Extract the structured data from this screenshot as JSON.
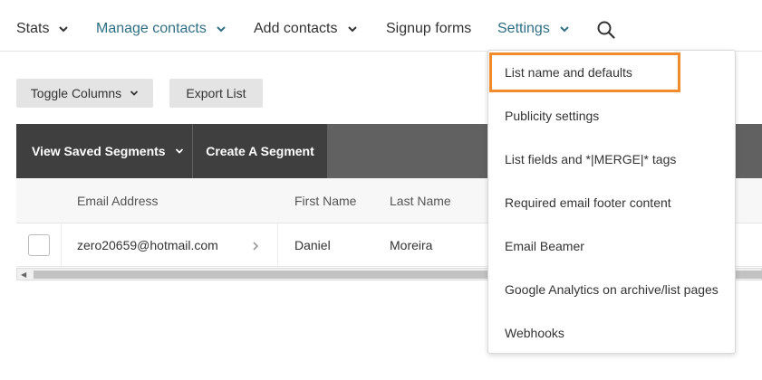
{
  "nav": {
    "stats": "Stats",
    "manage_contacts": "Manage contacts",
    "add_contacts": "Add contacts",
    "signup_forms": "Signup forms",
    "settings": "Settings",
    "search_icon": "search-icon"
  },
  "toolbar": {
    "toggle_columns": "Toggle Columns",
    "export_list": "Export List"
  },
  "segments": {
    "view_saved": "View Saved Segments",
    "create": "Create A Segment"
  },
  "table": {
    "headers": [
      "Email Address",
      "First Name",
      "Last Name"
    ],
    "rows": [
      {
        "email": "zero20659@hotmail.com",
        "first_name": "Daniel",
        "last_name": "Moreira"
      }
    ]
  },
  "settings_menu": {
    "items": [
      "List name and defaults",
      "Publicity settings",
      "List fields and *|MERGE|* tags",
      "Required email footer content",
      "Email Beamer",
      "Google Analytics on archive/list pages",
      "Webhooks"
    ]
  },
  "colors": {
    "accent_teal": "#2f6f84",
    "highlight_orange": "#f28a2e",
    "segment_bar": "#3f3f3f"
  }
}
